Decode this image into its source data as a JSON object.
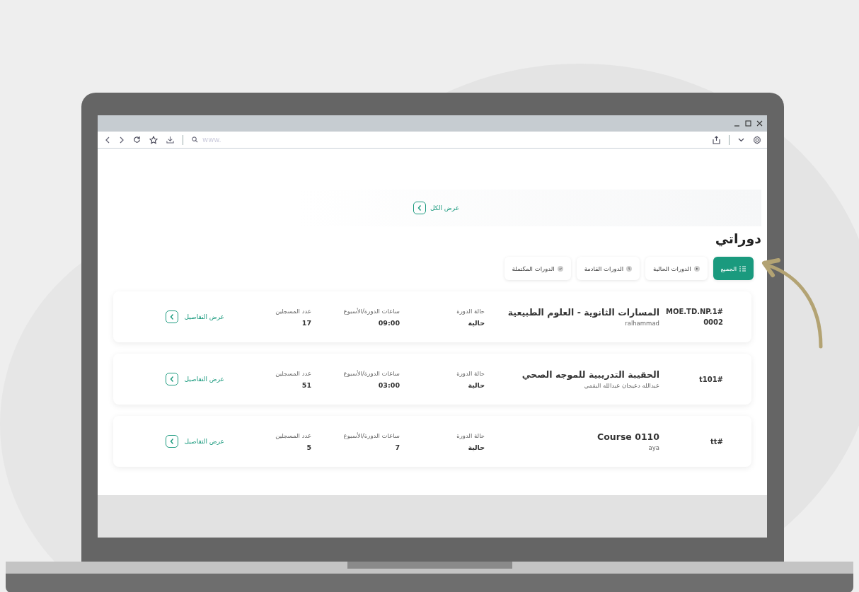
{
  "browser": {
    "url_placeholder": "www."
  },
  "view_all": "عرض الكل",
  "title": "دوراتي",
  "tabs": [
    {
      "label": "الجميع",
      "kind": "all",
      "selected": true
    },
    {
      "label": "الدورات الحالية",
      "kind": "current",
      "selected": false
    },
    {
      "label": "الدورات القادمة",
      "kind": "upcoming",
      "selected": false
    },
    {
      "label": "الدورات المكتملة",
      "kind": "completed",
      "selected": false
    }
  ],
  "courses": [
    {
      "code": "#MOE.TD.NP.1 0002",
      "name": "المسارات الثانوية - العلوم الطبيعية",
      "instructor": "ralhammad",
      "status_label": "حالة الدورة",
      "status": "حالية",
      "hours_label": "ساعات الدورة/الأسبوع",
      "hours": "09:00",
      "enrolled_label": "عدد المسجلين",
      "enrolled": "17",
      "details": "عرض التفاصيل"
    },
    {
      "code": "#t101",
      "name": "الحقيبة التدريبية للموجه الصحي",
      "instructor": "عبدالله دعيجان عبدالله البقمي",
      "status_label": "حالة الدورة",
      "status": "حالية",
      "hours_label": "ساعات الدورة/الأسبوع",
      "hours": "03:00",
      "enrolled_label": "عدد المسجلين",
      "enrolled": "51",
      "details": "عرض التفاصيل"
    },
    {
      "code": "#tt",
      "name": "Course 0110",
      "instructor": "aya",
      "status_label": "حالة الدورة",
      "status": "حالية",
      "hours_label": "ساعات الدورة/الأسبوع",
      "hours": "7",
      "enrolled_label": "عدد المسجلين",
      "enrolled": "5",
      "details": "عرض التفاصيل"
    }
  ]
}
